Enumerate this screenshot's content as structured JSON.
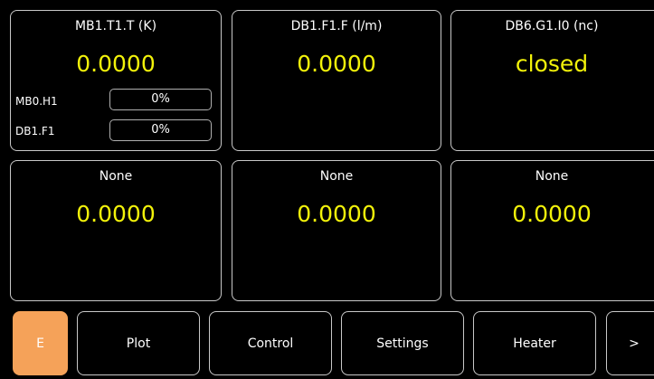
{
  "colors": {
    "background": "#000000",
    "value_text": "#f2f20a",
    "active_button": "#f5a259"
  },
  "panels": [
    {
      "title": "MB1.T1.T (K)",
      "value": "0.0000",
      "rows": [
        {
          "label": "MB0.H1",
          "value": "0%"
        },
        {
          "label": "DB1.F1",
          "value": "0%"
        }
      ]
    },
    {
      "title": "DB1.F1.F (l/m)",
      "value": "0.0000"
    },
    {
      "title": "DB6.G1.I0 (nc)",
      "value": "closed"
    },
    {
      "title": "None",
      "value": "0.0000"
    },
    {
      "title": "None",
      "value": "0.0000"
    },
    {
      "title": "None",
      "value": "0.0000"
    }
  ],
  "nav": {
    "buttons": [
      {
        "label": "E",
        "active": true
      },
      {
        "label": "Plot"
      },
      {
        "label": "Control"
      },
      {
        "label": "Settings"
      },
      {
        "label": "Heater"
      },
      {
        "label": ">"
      }
    ]
  }
}
